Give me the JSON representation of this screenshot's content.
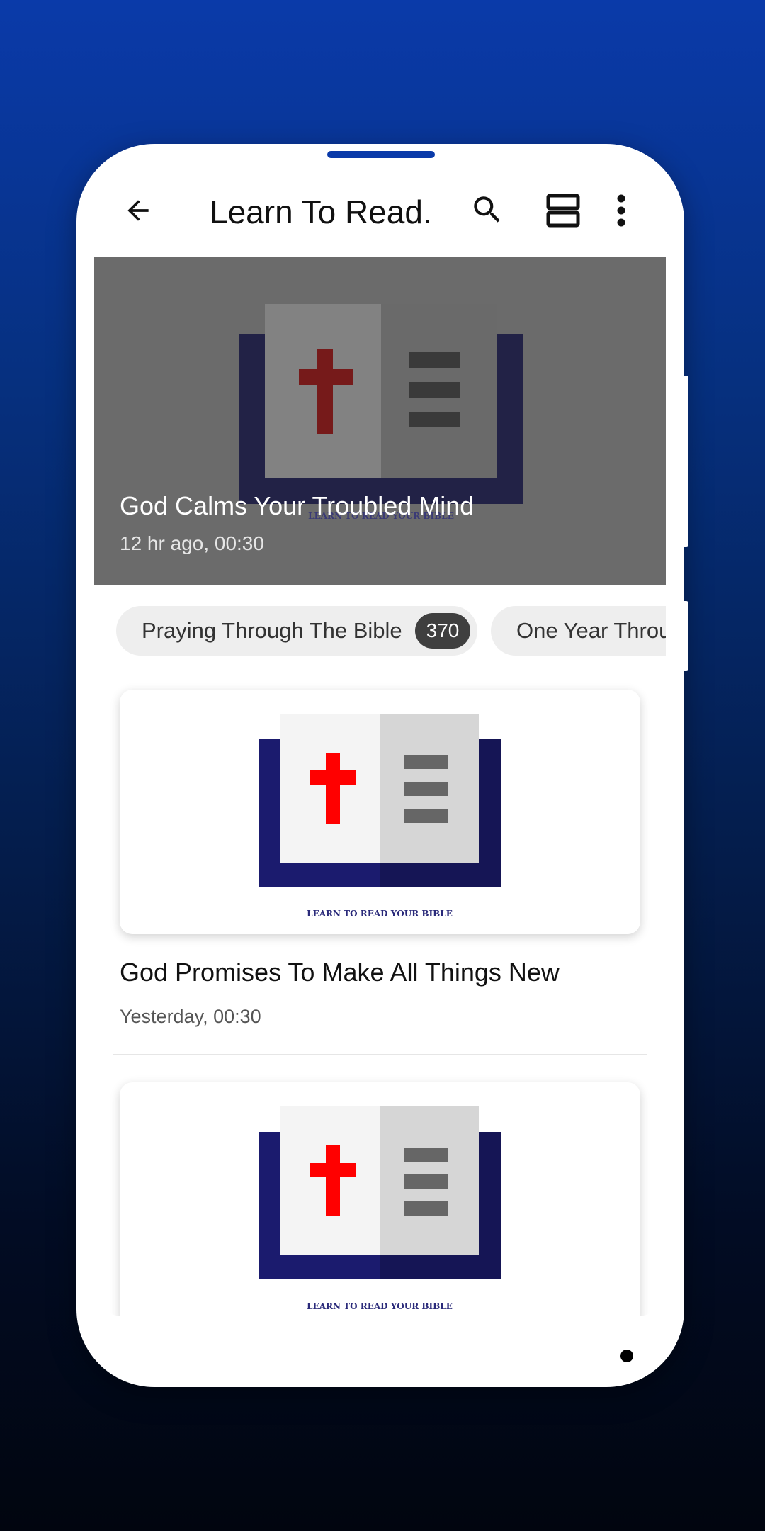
{
  "app_bar": {
    "title": "Learn To Read...",
    "back_icon": "arrow-back-icon",
    "search_icon": "search-icon",
    "view_icon": "view-agenda-icon",
    "more_icon": "more-vert-icon"
  },
  "hero": {
    "title": "God Calms Your Troubled Mind",
    "meta": "12 hr ago, 00:30",
    "art_caption": "LEARN TO READ YOUR BIBLE"
  },
  "chips": [
    {
      "label": "Praying Through The Bible",
      "count": "370"
    },
    {
      "label": "One Year Through The Bible",
      "count": ""
    }
  ],
  "episodes": [
    {
      "title": "God Promises To Make All Things New",
      "meta": "Yesterday, 00:30",
      "art_caption": "LEARN TO READ YOUR BIBLE"
    },
    {
      "title": "",
      "meta": "",
      "art_caption": "LEARN TO READ YOUR BIBLE"
    }
  ],
  "colors": {
    "background_top": "#0a3aa9",
    "background_bottom": "#01050f",
    "book_cover": "#1b1b6e",
    "cross": "#ff0000",
    "chip_count_bg": "#3f3f3f"
  }
}
